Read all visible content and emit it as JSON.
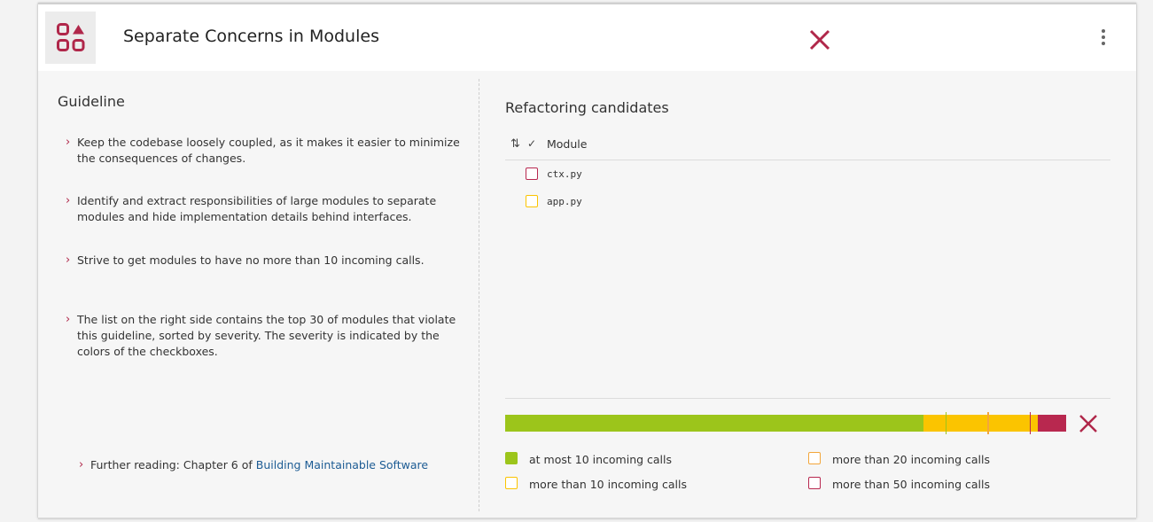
{
  "header": {
    "title": "Separate Concerns in Modules",
    "icon": "modules-icon",
    "close_icon": "close-icon",
    "menu_icon": "more-vertical-icon"
  },
  "guideline": {
    "title": "Guideline",
    "items": [
      "Keep the codebase loosely coupled, as it makes it easier to minimize the consequences of changes.",
      "Identify and extract responsibilities of large modules to separate modules and hide implementation details behind interfaces.",
      "Strive to get modules to have no more than 10 incoming calls.",
      "The list on the right side contains the top 30 of modules that violate this guideline, sorted by severity. The severity is indicated by the colors of the checkboxes."
    ],
    "further_reading_prefix": "Further reading: Chapter 6 of ",
    "further_reading_link": "Building Maintainable Software"
  },
  "candidates": {
    "title": "Refactoring candidates",
    "column_label": "Module",
    "rows": [
      {
        "label": "ctx.py",
        "severity": "red"
      },
      {
        "label": "app.py",
        "severity": "yellow"
      }
    ]
  },
  "colors": {
    "red": "#b8284f",
    "orange": "#f3a63b",
    "yellow": "#fbc400",
    "green": "#9cc51b",
    "accent": "#b0274a",
    "link": "#1d5c94"
  },
  "severity_bar": {
    "segments": [
      {
        "color": "green",
        "fraction": 0.7457
      },
      {
        "color": "yellow",
        "fraction": 0.2038
      },
      {
        "color": "red",
        "fraction": 0.0505
      }
    ],
    "markers": [
      {
        "color": "green",
        "fraction": 0.785
      },
      {
        "color": "orange",
        "fraction": 0.86
      },
      {
        "color": "red",
        "fraction": 0.935
      }
    ]
  },
  "legend": [
    {
      "label": "at most 10 incoming calls",
      "color": "green",
      "filled": true
    },
    {
      "label": "more than 20 incoming calls",
      "color": "orange",
      "filled": false
    },
    {
      "label": "more than 10 incoming calls",
      "color": "yellow",
      "filled": false
    },
    {
      "label": "more than 50 incoming calls",
      "color": "red",
      "filled": false
    }
  ]
}
